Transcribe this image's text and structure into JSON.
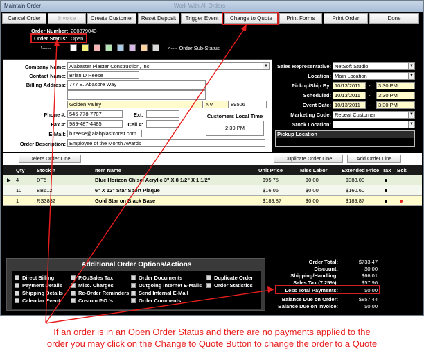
{
  "window": {
    "title": "Maintain Order",
    "caption": "Work With All Orders"
  },
  "toolbar": [
    {
      "label": "Cancel Order",
      "enabled": true
    },
    {
      "label": "Invoice",
      "enabled": false
    },
    {
      "label": "Create Customer",
      "enabled": true
    },
    {
      "label": "Reset Deposit",
      "enabled": true
    },
    {
      "label": "Trigger Event",
      "enabled": true
    },
    {
      "label": "Change to Quote",
      "enabled": true
    },
    {
      "label": "Print Forms",
      "enabled": true
    },
    {
      "label": "Print Order",
      "enabled": true
    },
    {
      "label": "Done",
      "enabled": true
    }
  ],
  "order": {
    "number_label": "Order Number:",
    "number": "200879043",
    "status_label": "Order Status:",
    "status": "Open",
    "substatus_label": "<---- Order Sub-Status",
    "substatus_arrow": "\\-----",
    "substatus_colors": [
      "#ffffff",
      "#f6f07a",
      "#f7b4b4",
      "#b7e3b3",
      "#a9cbe9",
      "#d8b8e6",
      "#fbd3a1",
      "#d9d9d9"
    ]
  },
  "customer": {
    "company_label": "Company Name:",
    "company": "Alabaster Plaster Construction, Inc.",
    "contact_label": "Contact Name:",
    "contact": "Brian D Reese",
    "billing_label": "Billing Address:",
    "address1": "777 E. Abacore Way",
    "address2": "",
    "city": "Golden Valley",
    "state": "NV",
    "zip": "89506",
    "phone_label": "Phone #:",
    "phone": "545-778-7787",
    "ext_label": "Ext:",
    "ext": "",
    "fax_label": "Fax #:",
    "fax": "989-487-4485",
    "cell_label": "Cell #:",
    "cell": "",
    "email_label": "E-Mail:",
    "email": "b.reese@alabplastconst.com",
    "desc_label": "Order Description:",
    "desc": "Employee of the Month Awards",
    "local_time_label": "Customers Local Time",
    "local_time": "2:39 PM"
  },
  "details": {
    "rep_label": "Sales Representative:",
    "rep": "NetSoft Studio",
    "location_label": "Location:",
    "location": "Main Location",
    "pickup_label": "Pickup/Ship By:",
    "pickup_date": "10/13/2011",
    "pickup_time": "3:30 PM",
    "scheduled_label": "Scheduled:",
    "scheduled_date": "10/13/2011",
    "scheduled_time": "3:30 PM",
    "event_label": "Event Date:",
    "event_date": "10/13/2011",
    "event_time": "3:30 PM",
    "dash": "-",
    "marketing_label": "Marketing Code:",
    "marketing": "Repeat Customer",
    "stock_label": "Stock Location:",
    "stock": "",
    "pickup_location_label": "Pickup Location"
  },
  "buttons": {
    "delete_line": "Delete Order Line",
    "duplicate_line": "Duplicate Order Line",
    "add_line": "Add Order Line"
  },
  "grid": {
    "headers": [
      "Qty",
      "Stock #",
      "Item Name",
      "Unit Price",
      "Misc Labor",
      "Extended Price",
      "Tax",
      "Bck"
    ],
    "rows": [
      {
        "indicator": "▶",
        "qty": "4",
        "stock": "DT5",
        "item": "Blue Horizon Chisel Acrylic 3\" X 8 1/2\" X 1 1/2\"",
        "unit": "$95.75",
        "labor": "$0.00",
        "ext": "$383.00",
        "tax": true,
        "bck": false
      },
      {
        "indicator": "",
        "qty": "10",
        "stock": "BB612",
        "item": "6\" X 12\" Star Sport Plaque",
        "unit": "$16.06",
        "labor": "$0.00",
        "ext": "$160.60",
        "tax": true,
        "bck": false
      },
      {
        "indicator": "",
        "qty": "1",
        "stock": "RS3832",
        "item": "Gold Star on Black Base",
        "unit": "$189.87",
        "labor": "$0.00",
        "ext": "$189.87",
        "tax": true,
        "bck": true
      }
    ]
  },
  "options": {
    "title": "Additional Order Options/Actions",
    "col1": [
      "Direct Billing",
      "Payment Details",
      "Shipping Details",
      "Calendar Event"
    ],
    "col2": [
      "P.O./Sales Tax",
      "Misc. Charges",
      "Re-Order Reminders",
      "Custom P.O.'s"
    ],
    "col3": [
      "Order Documents",
      "Outgoing Internet E-Mails",
      "Send Internal E-Mail",
      "Order Comments"
    ],
    "col4": [
      "Duplicate Order",
      "Order Statistics"
    ]
  },
  "totals": [
    {
      "label": "Order Total:",
      "value": "$733.47"
    },
    {
      "label": "Discount:",
      "value": "$0.00"
    },
    {
      "label": "Shipping/Handling:",
      "value": "$66.01"
    },
    {
      "label": "Sales Tax (7.25%):",
      "value": "$57.96"
    },
    {
      "label": "Less Total Payments:",
      "value": "$0.00"
    },
    {
      "label": "Balance Due on Order:",
      "value": "$857.44"
    },
    {
      "label": "Balance Due on Invoice:",
      "value": "$0.00"
    }
  ],
  "caption": {
    "line1": "If an order is in an Open Order Status and there are no payments applied to the",
    "line2": "order you may click on the Change to Quote Button to change the order to a Quote"
  },
  "colors": {
    "highlight": "#d42020",
    "yellow_field": "#fffbcc",
    "row_alt": "#e6efda",
    "row_mid": "#f4f7ee",
    "row_yellow": "#fffbcc",
    "annotation": "#e81d1d"
  }
}
